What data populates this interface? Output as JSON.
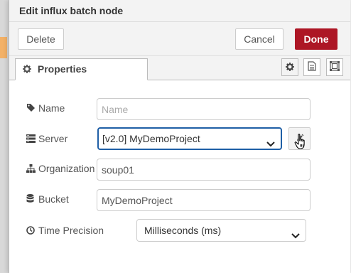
{
  "header": {
    "title": "Edit influx batch node"
  },
  "toolbar": {
    "delete_label": "Delete",
    "cancel_label": "Cancel",
    "done_label": "Done"
  },
  "tabs": {
    "properties_label": "Properties",
    "icons": [
      "gear-icon",
      "description-icon",
      "appearance-icon"
    ]
  },
  "form": {
    "name": {
      "label": "Name",
      "value": "",
      "placeholder": "Name",
      "icon": "tag-icon"
    },
    "server": {
      "label": "Server",
      "value": "[v2.0] MyDemoProject",
      "icon": "server-icon"
    },
    "organization": {
      "label": "Organization",
      "value": "soup01",
      "icon": "sitemap-icon"
    },
    "bucket": {
      "label": "Bucket",
      "value": "MyDemoProject",
      "icon": "database-icon"
    },
    "time_precision": {
      "label": "Time Precision",
      "value": "Milliseconds (ms)",
      "icon": "clock-icon"
    }
  },
  "colors": {
    "done_bg": "#ad1625",
    "focus_border": "#1f5fa6",
    "accent_strip": "#f3b167"
  }
}
